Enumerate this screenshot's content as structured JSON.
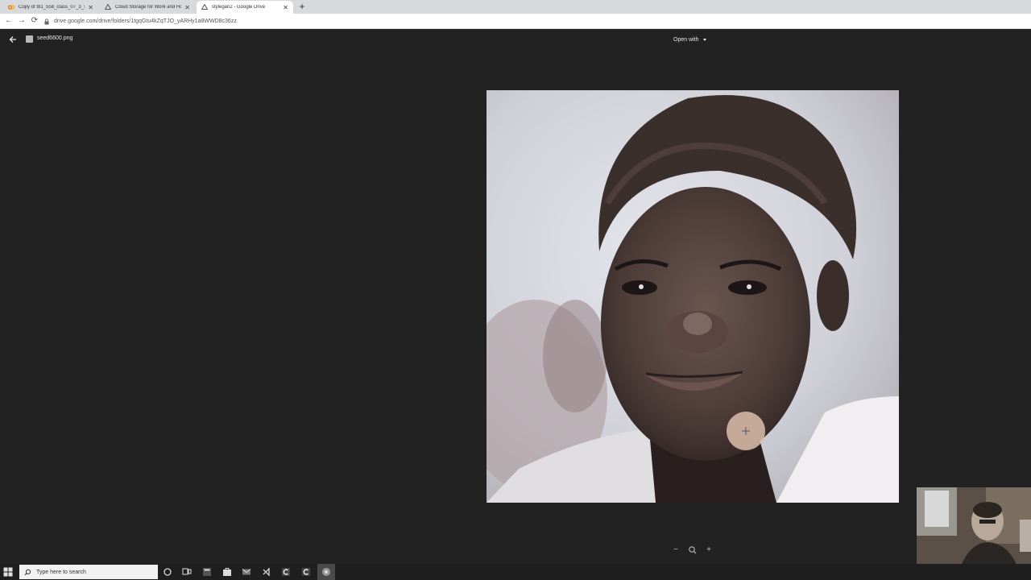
{
  "browser": {
    "tabs": [
      {
        "title": "Copy of t81_558_class_07_3_sty",
        "icon": "colab-icon",
        "active": false
      },
      {
        "title": "Cloud Storage for Work and Ho",
        "icon": "drive-icon",
        "active": false
      },
      {
        "title": "stylegan2 - Google Drive",
        "icon": "drive-icon",
        "active": true
      }
    ],
    "new_tab": "+",
    "close_glyph": "✕",
    "url": "drive.google.com/drive/folders/1tgqGtu4kZqTJO_yARHy1a8WWD8c36zz"
  },
  "viewer": {
    "file_name": "seed6600.png",
    "open_with": "Open with"
  },
  "zoom": {
    "minus": "−",
    "plus": "+"
  },
  "taskbar": {
    "search_placeholder": "Type here to search"
  },
  "colors": {
    "viewer_bg": "#222222",
    "taskbar_bg": "#1f1f1f"
  }
}
